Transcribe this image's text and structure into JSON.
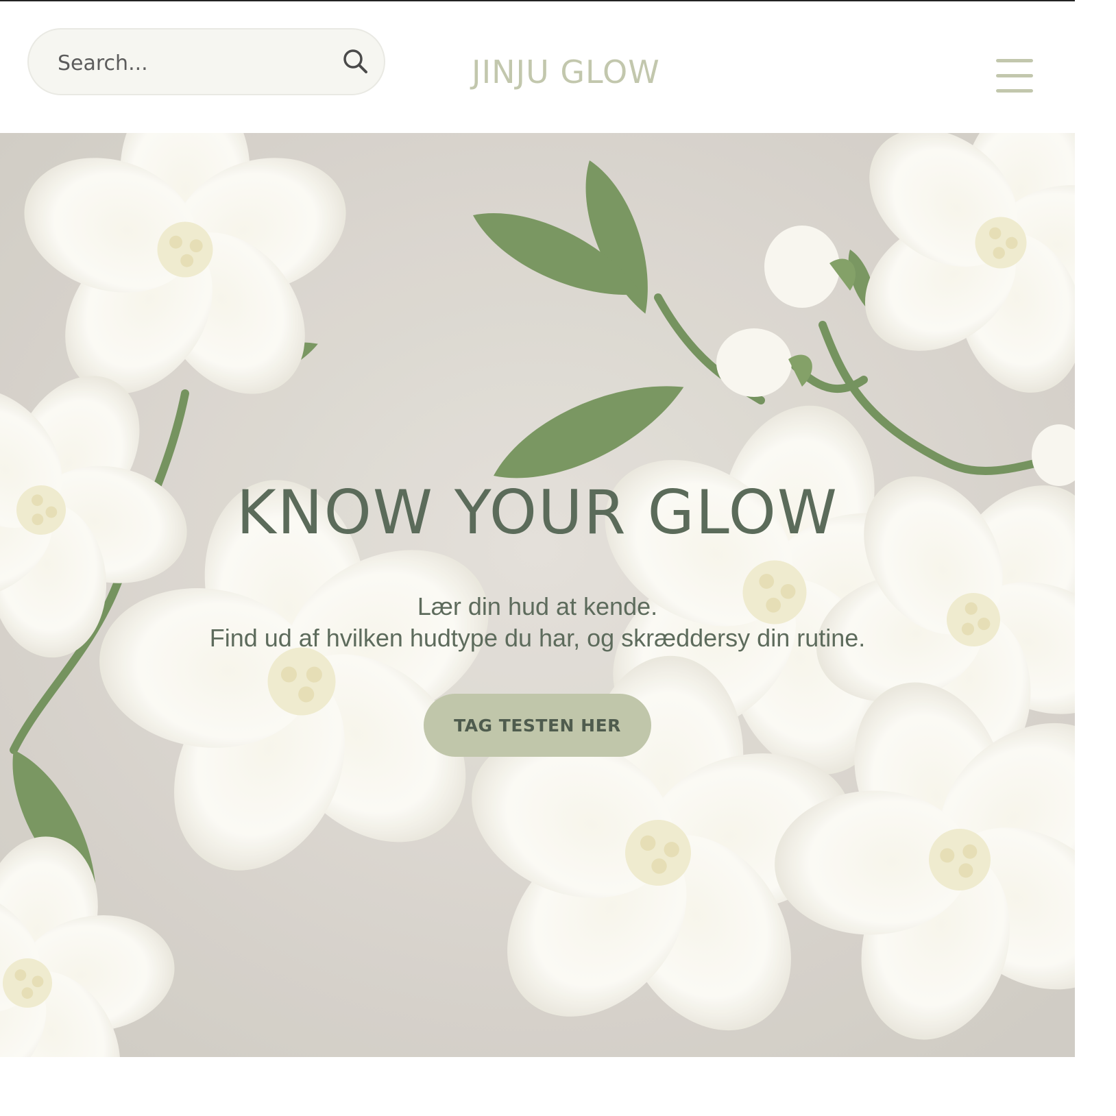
{
  "header": {
    "search": {
      "placeholder": "Search...",
      "icon": "search-icon"
    },
    "logo": "JINJU GLOW",
    "menu_icon": "hamburger-menu-icon"
  },
  "hero": {
    "title": "KNOW YOUR GLOW",
    "subtitle_line1": "Lær din hud at kende.",
    "subtitle_line2": "Find ud af hvilken hudtype du har, og skræddersy din rutine.",
    "cta_label": "TAG TESTEN HER",
    "background": "white jasmine flowers with green leaves on beige"
  },
  "colors": {
    "accent": "#c0c6aa",
    "logo": "#c2c7ad",
    "heading": "#5b6b5a",
    "hero_bg": "#d9d5ce"
  }
}
